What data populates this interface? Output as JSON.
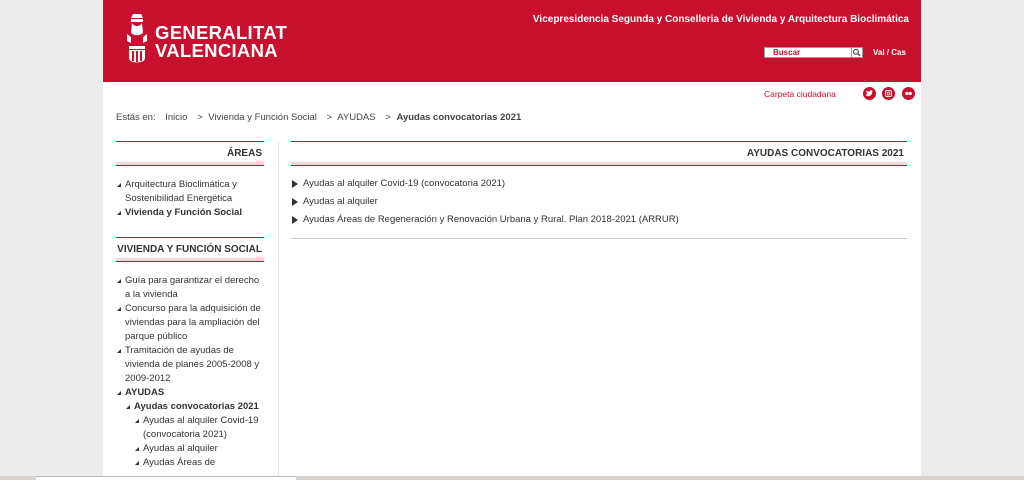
{
  "header": {
    "logo_line1": "GENERALITAT",
    "logo_line2": "VALENCIANA",
    "title": "Vicepresidencia Segunda y Conselleria de Vivienda y Arquitectura Bioclimática",
    "search_placeholder": "Buscar",
    "lang": "Val / Cas"
  },
  "topbar": {
    "carpeta": "Carpeta ciudadana",
    "social": [
      "twitter-icon",
      "instagram-icon",
      "flickr-icon"
    ]
  },
  "breadcrumb": {
    "prefix": "Estás en:",
    "items": [
      "Inicio",
      "Vivienda y Función Social",
      "AYUDAS"
    ],
    "current": "Ayudas convocatorias 2021",
    "sep": ">"
  },
  "sidebar": {
    "areas_title": "ÁREAS",
    "areas": [
      "Arquitectura Bioclimática y Sostenibilidad Energética",
      "Vivienda y Función Social"
    ],
    "section_title": "VIVIENDA Y FUNCIÓN SOCIAL",
    "section_items": [
      "Guía para garantizar el derecho a la vivienda",
      "Concurso para la adquisición de viviendas para la ampliación del parque público",
      "Tramitación de ayudas de vivienda de planes 2005-2008 y 2009-2012",
      "AYUDAS",
      "Ayudas convocatorias 2021",
      "Ayudas al alquiler Covid-19 (convocatoria 2021)",
      "Ayudas al alquiler",
      "Ayudas Áreas de"
    ]
  },
  "main": {
    "title": "AYUDAS CONVOCATORIAS 2021",
    "links": [
      "Ayudas al alquiler Covid-19 (convocatoria 2021)",
      "Ayudas al alquiler",
      "Ayudas Áreas de Regeneración y Renovación Urbana y Rural. Plan 2018-2021 (ARRUR)"
    ]
  },
  "colors": {
    "brand": "#c8102e"
  }
}
